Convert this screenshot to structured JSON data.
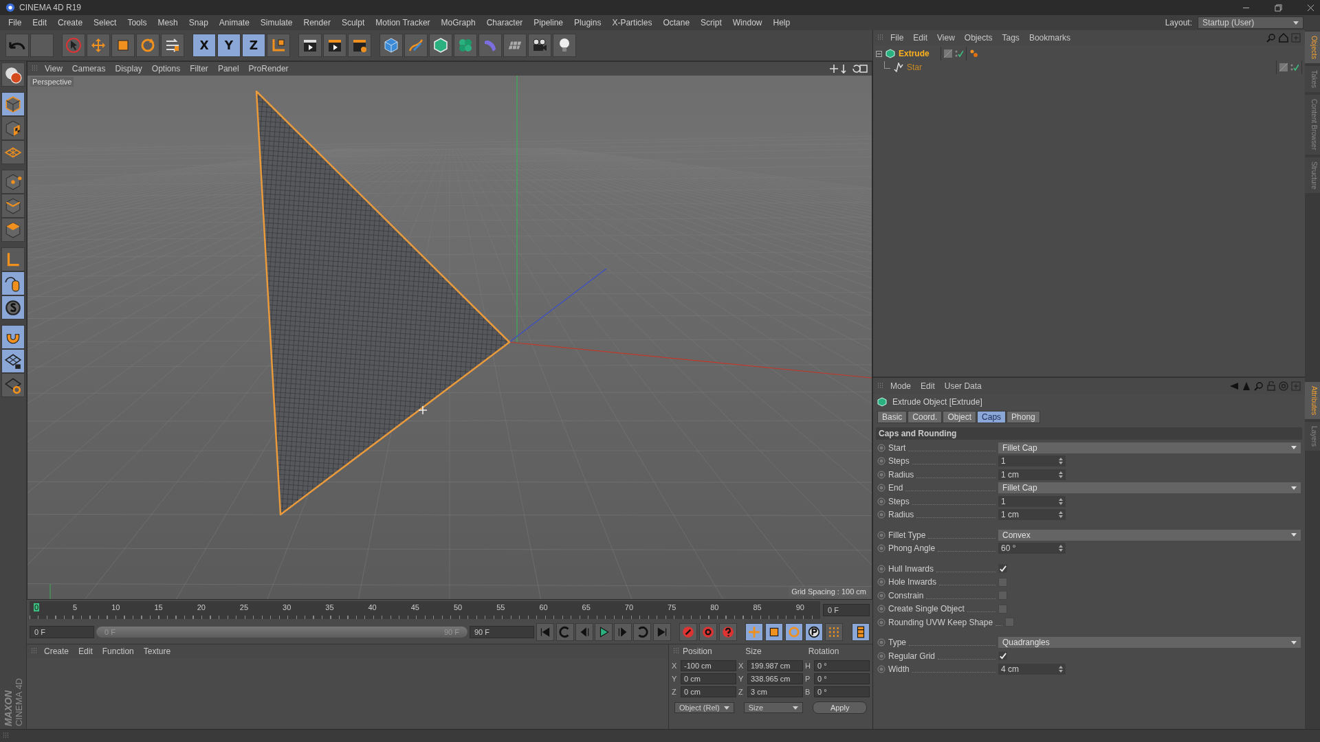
{
  "window": {
    "title": "CINEMA 4D R19"
  },
  "menu": [
    "File",
    "Edit",
    "Create",
    "Select",
    "Tools",
    "Mesh",
    "Snap",
    "Animate",
    "Simulate",
    "Render",
    "Sculpt",
    "Motion Tracker",
    "MoGraph",
    "Character",
    "Pipeline",
    "Plugins",
    "X-Particles",
    "Octane",
    "Script",
    "Window",
    "Help"
  ],
  "layout": {
    "label": "Layout:",
    "value": "Startup (User)"
  },
  "axis_locks": [
    {
      "label": "X",
      "on": true
    },
    {
      "label": "Y",
      "on": true
    },
    {
      "label": "Z",
      "on": true
    }
  ],
  "left_tools": [
    {
      "kind": "model",
      "selected": false
    },
    {
      "kind": "object",
      "selected": true
    },
    {
      "kind": "texture",
      "selected": false
    },
    {
      "kind": "workplane",
      "selected": false
    },
    {
      "kind": "points",
      "selected": false
    },
    {
      "kind": "edges",
      "selected": false
    },
    {
      "kind": "polygons",
      "selected": false
    },
    {
      "kind": "axis",
      "selected": false
    },
    {
      "kind": "tweak",
      "selected": true
    },
    {
      "kind": "solo",
      "selected": true
    },
    {
      "kind": "snap",
      "selected": true
    },
    {
      "kind": "lock",
      "selected": true
    },
    {
      "kind": "planar",
      "selected": false
    }
  ],
  "viewport": {
    "menu": [
      "View",
      "Cameras",
      "Display",
      "Options",
      "Filter",
      "Panel",
      "ProRender"
    ],
    "label": "Perspective",
    "grid_spacing": "Grid Spacing : 100 cm"
  },
  "timeline": {
    "ticks": [
      {
        "label": "0",
        "selected": true
      },
      {
        "label": "5",
        "selected": false
      },
      {
        "label": "10",
        "selected": false
      },
      {
        "label": "15",
        "selected": false
      },
      {
        "label": "20",
        "selected": false
      },
      {
        "label": "25",
        "selected": false
      },
      {
        "label": "30",
        "selected": false
      },
      {
        "label": "35",
        "selected": false
      },
      {
        "label": "40",
        "selected": false
      },
      {
        "label": "45",
        "selected": false
      },
      {
        "label": "50",
        "selected": false
      },
      {
        "label": "55",
        "selected": false
      },
      {
        "label": "60",
        "selected": false
      },
      {
        "label": "65",
        "selected": false
      },
      {
        "label": "70",
        "selected": false
      },
      {
        "label": "75",
        "selected": false
      },
      {
        "label": "80",
        "selected": false
      },
      {
        "label": "85",
        "selected": false
      },
      {
        "label": "90",
        "selected": false
      }
    ],
    "current": "0 F"
  },
  "playback": {
    "start": "0 F",
    "range_start": "0 F",
    "range_end": "90 F",
    "level": 1,
    "end": "90 F"
  },
  "material_manager": {
    "menu": [
      "Create",
      "Edit",
      "Function",
      "Texture"
    ]
  },
  "coordinates": {
    "headers": [
      "Position",
      "Size",
      "Rotation"
    ],
    "rows": [
      {
        "axis": "X",
        "position": "-100 cm",
        "size_axis": "X",
        "size": "199.987 cm",
        "rotation_axis": "H",
        "rotation": "0 °"
      },
      {
        "axis": "Y",
        "position": "0 cm",
        "size_axis": "Y",
        "size": "338.965 cm",
        "rotation_axis": "P",
        "rotation": "0 °"
      },
      {
        "axis": "Z",
        "position": "0 cm",
        "size_axis": "Z",
        "size": "3 cm",
        "rotation_axis": "B",
        "rotation": "0 °"
      }
    ],
    "mode": "Object (Rel)",
    "size_mode": "Size",
    "apply": "Apply"
  },
  "logo": {
    "brand": "MAXON",
    "product": "CINEMA 4D"
  },
  "object_manager": {
    "menu": [
      "File",
      "Edit",
      "View",
      "Objects",
      "Tags",
      "Bookmarks"
    ],
    "objects": [
      {
        "name": "Extrude",
        "selected": true,
        "expanded": true,
        "children": [
          {
            "name": "Star",
            "selected": false
          }
        ]
      }
    ]
  },
  "side_tabs_top": [
    {
      "label": "Objects",
      "selected": true
    },
    {
      "label": "Takes",
      "selected": false
    },
    {
      "label": "Content Browser",
      "selected": false
    },
    {
      "label": "Structure",
      "selected": false
    }
  ],
  "attributes": {
    "menu": [
      "Mode",
      "Edit",
      "User Data"
    ],
    "title": "Extrude Object [Extrude]",
    "tabs": [
      {
        "label": "Basic",
        "selected": false
      },
      {
        "label": "Coord.",
        "selected": false
      },
      {
        "label": "Object",
        "selected": false
      },
      {
        "label": "Caps",
        "selected": true
      },
      {
        "label": "Phong",
        "selected": false
      }
    ],
    "section": "Caps and Rounding",
    "groups": [
      [
        {
          "kind": "dropdown",
          "label": "Start",
          "value": "Fillet Cap"
        },
        {
          "kind": "number",
          "label": "Steps",
          "value": "1"
        },
        {
          "kind": "number",
          "label": "Radius",
          "value": "1 cm"
        },
        {
          "kind": "dropdown",
          "label": "End",
          "value": "Fillet Cap"
        },
        {
          "kind": "number",
          "label": "Steps",
          "value": "1"
        },
        {
          "kind": "number",
          "label": "Radius",
          "value": "1 cm"
        }
      ],
      [
        {
          "kind": "dropdown",
          "label": "Fillet Type",
          "value": "Convex"
        },
        {
          "kind": "number",
          "label": "Phong Angle",
          "value": "60 °"
        }
      ],
      [
        {
          "kind": "checkbox",
          "label": "Hull Inwards",
          "checked": true
        },
        {
          "kind": "checkbox",
          "label": "Hole Inwards",
          "checked": false
        },
        {
          "kind": "checkbox",
          "label": "Constrain",
          "checked": false
        },
        {
          "kind": "checkbox",
          "label": "Create Single Object",
          "checked": false
        },
        {
          "kind": "checkbox",
          "label": "Rounding UVW Keep Shape",
          "checked": false
        }
      ],
      [
        {
          "kind": "dropdown",
          "label": "Type",
          "value": "Quadrangles"
        },
        {
          "kind": "checkbox",
          "label": "Regular Grid",
          "checked": true
        },
        {
          "kind": "number",
          "label": "Width",
          "value": "4 cm"
        }
      ]
    ]
  },
  "side_tabs_bottom": [
    {
      "label": "Attributes",
      "selected": true
    },
    {
      "label": "Layers",
      "selected": false
    }
  ]
}
